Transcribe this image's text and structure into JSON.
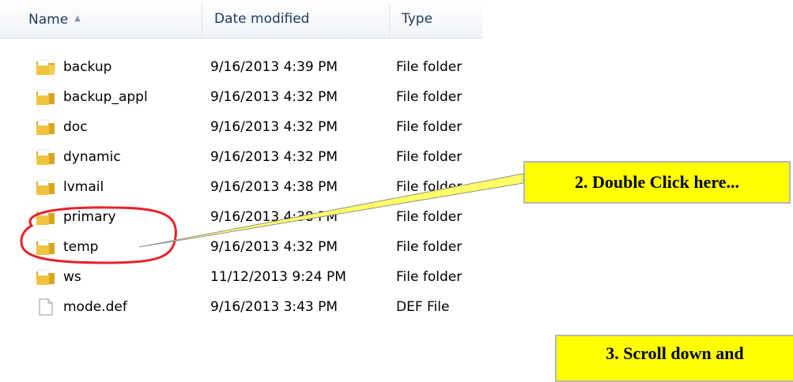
{
  "columns": {
    "name": "Name",
    "date": "Date modified",
    "type": "Type"
  },
  "files": [
    {
      "name": "backup",
      "date": "9/16/2013 4:39 PM",
      "type": "File folder",
      "icon": "folder-icon"
    },
    {
      "name": "backup_appl",
      "date": "9/16/2013 4:32 PM",
      "type": "File folder",
      "icon": "folder-icon"
    },
    {
      "name": "doc",
      "date": "9/16/2013 4:32 PM",
      "type": "File folder",
      "icon": "folder-icon"
    },
    {
      "name": "dynamic",
      "date": "9/16/2013 4:32 PM",
      "type": "File folder",
      "icon": "folder-icon"
    },
    {
      "name": "lvmail",
      "date": "9/16/2013 4:38 PM",
      "type": "File folder",
      "icon": "folder-icon"
    },
    {
      "name": "primary",
      "date": "9/16/2013 4:38 PM",
      "type": "File folder",
      "icon": "folder-icon"
    },
    {
      "name": "temp",
      "date": "9/16/2013 4:32 PM",
      "type": "File folder",
      "icon": "folder-icon"
    },
    {
      "name": "ws",
      "date": "11/12/2013 9:24 PM",
      "type": "File folder",
      "icon": "folder-icon"
    },
    {
      "name": "mode.def",
      "date": "9/16/2013 3:43 PM",
      "type": "DEF File",
      "icon": "file-icon"
    }
  ],
  "annotations": {
    "step2": "2. Double Click here...",
    "step3": "3. Scroll down and"
  },
  "colors": {
    "callout_fill": "#ffff00",
    "highlight_ring": "#e8232a",
    "header_text": "#1e395b"
  }
}
